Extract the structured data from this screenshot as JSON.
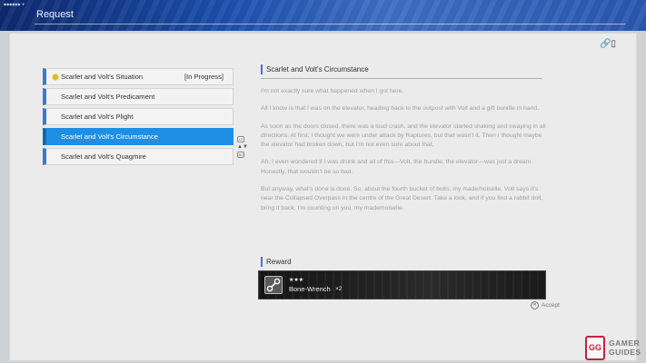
{
  "header": {
    "tag": "◆◆◆◆◆◆ ▼",
    "title": "Request"
  },
  "toolbar": {
    "link_icon_glyph": "🔗▯"
  },
  "quests": [
    {
      "label": "Scarlet and Volt's Situation",
      "status": "[In Progress]",
      "active": false,
      "in_progress": true
    },
    {
      "label": "Scarlet and Volt's Predicament",
      "status": "",
      "active": false
    },
    {
      "label": "Scarlet and Volt's Plight",
      "status": "",
      "active": false
    },
    {
      "label": "Scarlet and Volt's Circumstance",
      "status": "",
      "active": true
    },
    {
      "label": "Scarlet and Volt's Quagmire",
      "status": "",
      "active": false
    }
  ],
  "scroll": {
    "up_key": "L2",
    "down_key": "R2",
    "arrows": "▲▼"
  },
  "detail": {
    "title": "Scarlet and Volt's Circumstance",
    "paragraphs": [
      "I'm not exactly sure what happened when I got here.",
      "All I know is that I was on the elevator, heading back to the outpost with Volt and a gift bundle in hand.",
      "As soon as the doors closed, there was a loud crash, and the elevator started shaking and swaying in all directions. At first, I thought we were under attack by Raptures, but that wasn't it. Then I thought maybe the elevator had broken down, but I'm not even sure about that.",
      "Ah, I even wondered if I was drunk and all of this—Volt, the bundle, the elevator—was just a dream. Honestly, that wouldn't be so bad.",
      "But anyway, what's done is done. So, about the fourth bucket of bolts, my mademoiselle. Volt says it's near the Collapsed Overpass in the centre of the Great Desert. Take a look, and if you find a rabbit doll, bring it back. I'm counting on you, my mademoiselle."
    ]
  },
  "reward": {
    "heading": "Reward",
    "stars": "★★★",
    "name": "Bone-Wrench",
    "qty": "×2",
    "icon": "wrench-icon"
  },
  "footer": {
    "accept_button": "✕",
    "accept_label": "Accept"
  },
  "watermark": {
    "mark": "GG",
    "line1": "GAMER",
    "line2": "GUIDES"
  },
  "colors": {
    "accent": "#1f8fe6",
    "header": "#1c4fae",
    "logo": "#c2233a"
  }
}
